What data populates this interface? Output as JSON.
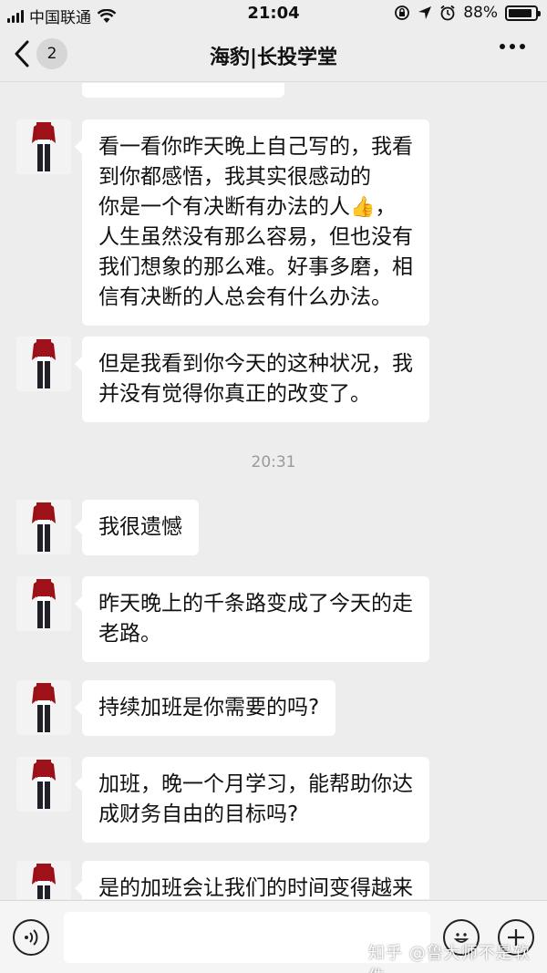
{
  "status_bar": {
    "carrier": "中国联通",
    "time": "21:04",
    "battery": "88%",
    "battery_level": 0.88,
    "icons": [
      "signal-icon",
      "wifi-icon",
      "lock-rotation-icon",
      "location-icon",
      "alarm-icon",
      "battery-icon"
    ]
  },
  "nav": {
    "unread_count": "2",
    "title": "海豹|长投学堂",
    "icons": [
      "chevron-left-icon",
      "more-icon"
    ]
  },
  "messages": [
    {
      "text": "看一看你昨天晚上自己写的，我看\n到你都感悟，我其实很感动的\n你是一个有决断有办法的人",
      "emoji": "👍",
      "text2": "，\n人生虽然没有那么容易，但也没有\n我们想象的那么难。好事多磨，相\n信有决断的人总会有什么办法。"
    },
    {
      "text": "但是我看到你今天的这种状况，我\n并没有觉得你真正的改变了。"
    },
    {
      "text": "我很遗憾"
    },
    {
      "text": "昨天晚上的千条路变成了今天的走\n老路。"
    },
    {
      "text": "持续加班是你需要的吗?"
    },
    {
      "text": "加班，晚一个月学习，能帮助你达\n成财务自由的目标吗?"
    },
    {
      "text": "是的加班会让我们的时间变得越来"
    }
  ],
  "timestamp": "20:31",
  "input_bar": {
    "value": "",
    "icons": [
      "voice-icon",
      "emoji-icon",
      "plus-icon"
    ]
  },
  "watermark": "知乎 @鲁大师不是软件"
}
